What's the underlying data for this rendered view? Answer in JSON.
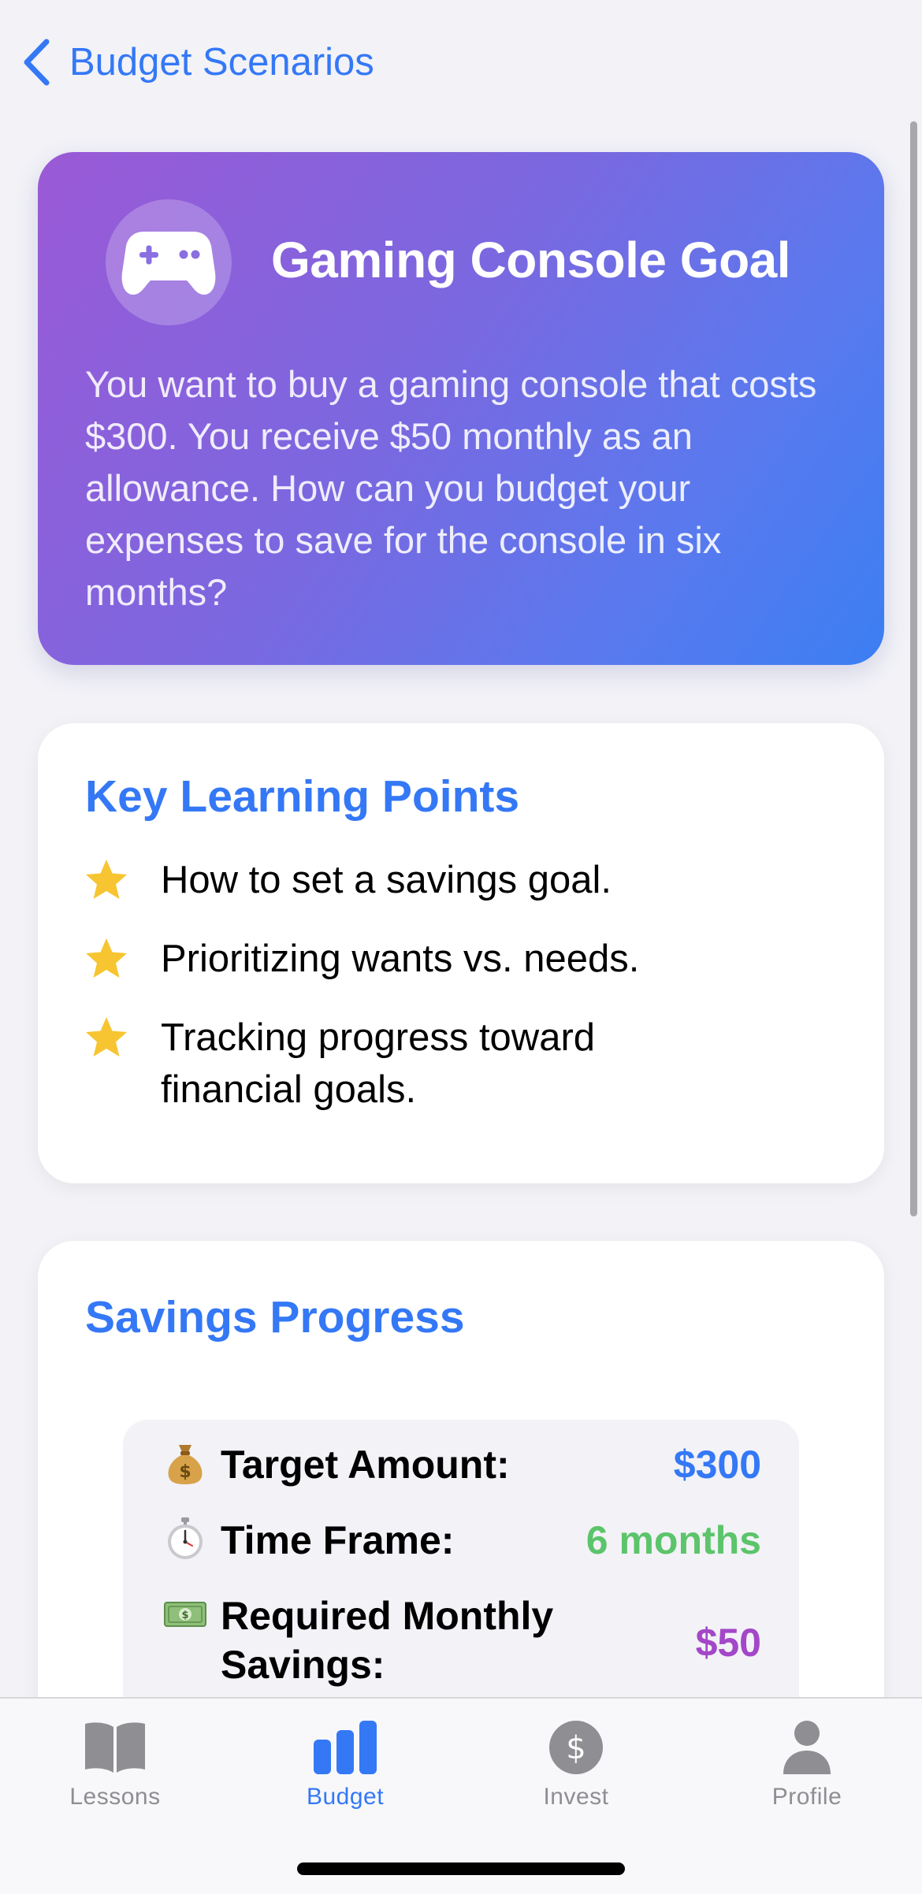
{
  "nav": {
    "back_label": "Budget Scenarios"
  },
  "hero": {
    "icon": "gamecontroller-icon",
    "title": "Gaming Console Goal",
    "description": "You want to buy a gaming console that costs $300. You receive $50 monthly as an allowance. How can you budget your expenses to save for the console in six months?"
  },
  "learning": {
    "title": "Key Learning Points",
    "points": [
      "How to set a savings goal.",
      "Prioritizing wants vs. needs.",
      "Tracking progress toward financial goals."
    ]
  },
  "savings": {
    "title": "Savings Progress",
    "rows": [
      {
        "emoji": "money-bag-icon",
        "label": "Target Amount:",
        "value": "$300",
        "color": "#3478f6"
      },
      {
        "emoji": "stopwatch-icon",
        "label": "Time Frame:",
        "value": "6 months",
        "color": "#5cc46a"
      },
      {
        "emoji": "dollar-banknote-icon",
        "label": "Required Monthly Savings:",
        "value": "$50",
        "color": "#a347c8"
      }
    ]
  },
  "tabbar": {
    "active_color": "#3478f6",
    "inactive_color": "#8e8e93",
    "tabs": [
      {
        "label": "Lessons",
        "icon": "book-icon",
        "active": false
      },
      {
        "label": "Budget",
        "icon": "chart-bar-icon",
        "active": true
      },
      {
        "label": "Invest",
        "icon": "dollar-circle-icon",
        "active": false
      },
      {
        "label": "Profile",
        "icon": "person-icon",
        "active": false
      }
    ]
  }
}
